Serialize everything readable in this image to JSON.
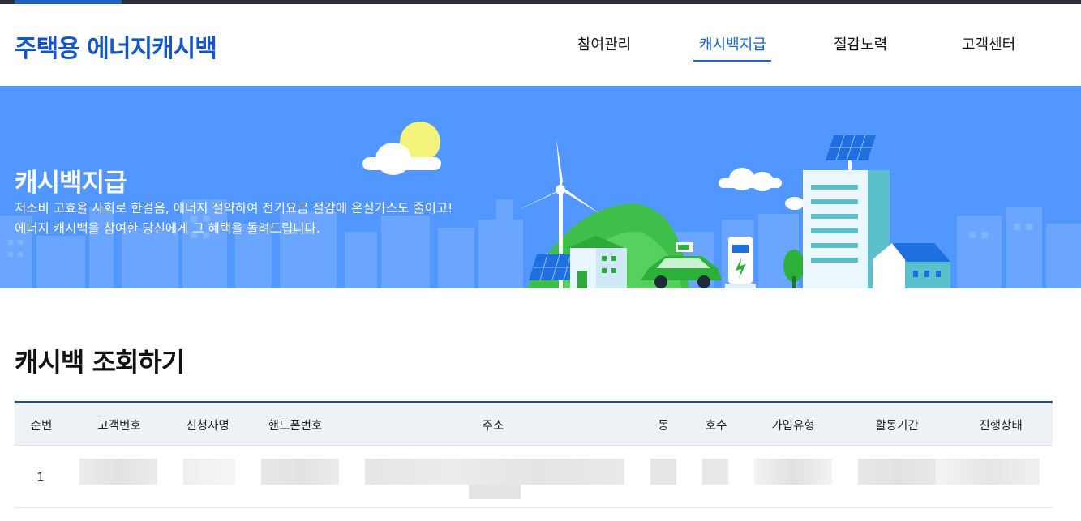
{
  "header": {
    "logo": "주택용 에너지캐시백",
    "nav": [
      {
        "label": "참여관리",
        "active": false
      },
      {
        "label": "캐시백지급",
        "active": true
      },
      {
        "label": "절감노력",
        "active": false
      },
      {
        "label": "고객센터",
        "active": false
      }
    ]
  },
  "hero": {
    "title": "캐시백지급",
    "line1": "저소비 고효율 사회로 한걸음, 에너지 절약하여 전기요금 절감에 온실가스도 줄이고!",
    "line2": "에너지 캐시백을 참여한 당신에게 그 혜택을 돌려드립니다."
  },
  "section": {
    "title": "캐시백 조회하기"
  },
  "table": {
    "columns": [
      "순번",
      "고객번호",
      "신청자명",
      "핸드폰번호",
      "주소",
      "동",
      "호수",
      "가입유형",
      "활동기간",
      "진행상태"
    ],
    "rows": [
      {
        "no": "1"
      }
    ]
  },
  "colors": {
    "brand": "#1456c8",
    "nav_active": "#1565d6",
    "hero_bg": "#5297ff",
    "table_border": "#1d4f8c",
    "table_header_bg": "#eef2f6"
  }
}
